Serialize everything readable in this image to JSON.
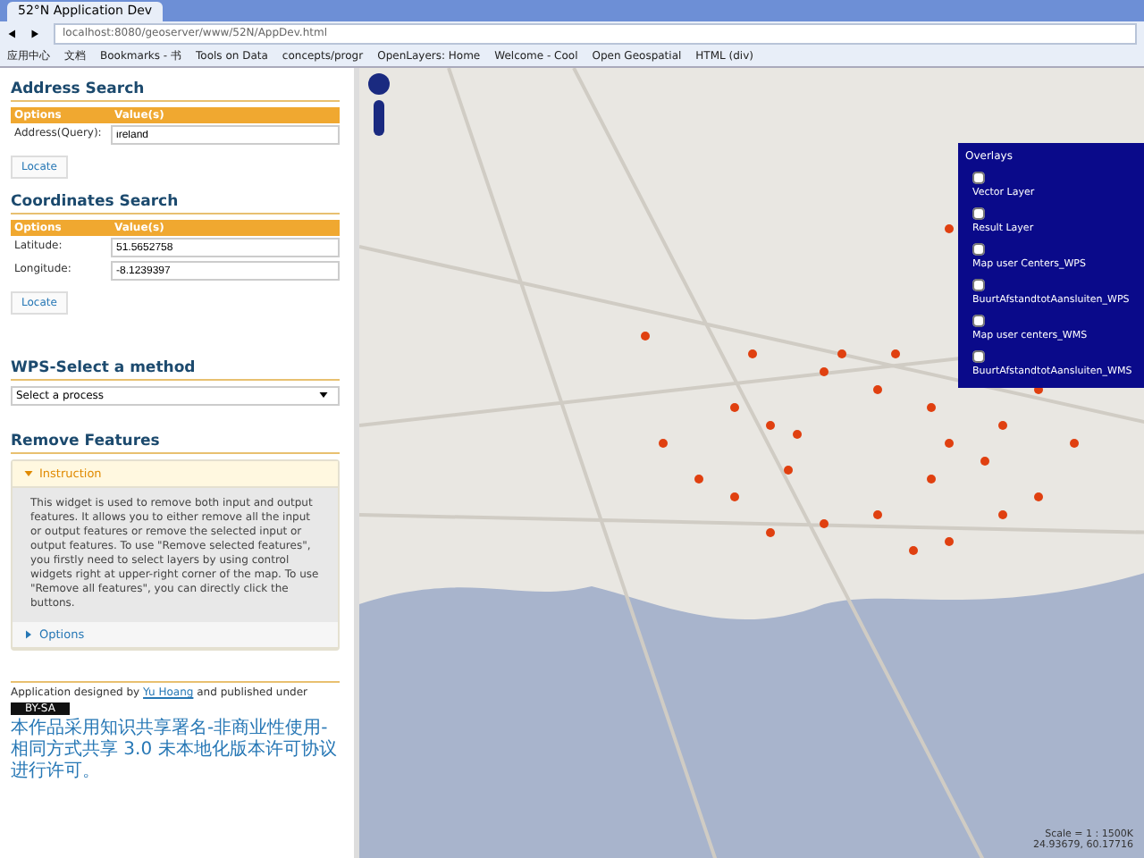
{
  "browser": {
    "tab_title": "52°N Application Dev",
    "url": "localhost:8080/geoserver/www/52N/AppDev.html",
    "bookmarks": [
      "应用中心",
      "文档",
      "Bookmarks - 书",
      "Tools on Data",
      "concepts/progr",
      "OpenLayers: Home",
      "Welcome - Cool",
      "Open Geospatial",
      "HTML (div)"
    ]
  },
  "address_search": {
    "title": "Address Search",
    "columns": [
      "Options",
      "Value(s)"
    ],
    "rows": [
      {
        "label": "Address(Query):",
        "value": "ireland"
      }
    ],
    "button": "Locate"
  },
  "coordinates_search": {
    "title": "Coordinates Search",
    "columns": [
      "Options",
      "Value(s)"
    ],
    "rows": [
      {
        "label": "Latitude:",
        "value": "51.5652758"
      },
      {
        "label": "Longitude:",
        "value": "-8.1239397"
      }
    ],
    "button": "Locate"
  },
  "wps": {
    "title": "WPS-Select a method",
    "select": "Select a process"
  },
  "remove_features": {
    "title": "Remove Features",
    "sections": [
      {
        "title": "Instruction",
        "expanded": true,
        "text": "This widget is used to remove both input and output features. It allows you to either remove all the input or output features or remove the selected input or output features. To use \"Remove selected features\", you firstly need to select layers by using control widgets right at upper-right corner of the map. To use \"Remove all features\", you can directly click the buttons."
      },
      {
        "title": "Options",
        "expanded": false
      }
    ]
  },
  "footer": {
    "credit_before": "Application designed by",
    "author": "Yu Hoang",
    "credit_after": "and published under",
    "license_badge": "BY-SA",
    "license_text": "本作品采用知识共享署名-非商业性使用-相同方式共享 3.0 未本地化版本许可协议进行许可。"
  },
  "overlays": {
    "title": "Overlays",
    "layers": [
      {
        "name": "Vector Layer",
        "checked": false
      },
      {
        "name": "Result Layer",
        "checked": false
      },
      {
        "name": "Map user Centers_WPS",
        "checked": false
      },
      {
        "name": "BuurtAfstandtotAansluiten_WPS",
        "checked": false
      },
      {
        "name": "Map user centers_WMS",
        "checked": false
      },
      {
        "name": "BuurtAfstandtotAansluiten_WMS",
        "checked": false
      }
    ]
  },
  "map_info": {
    "scale": "Scale = 1 : 1500K",
    "coordinates": "24.93679, 60.17716"
  }
}
